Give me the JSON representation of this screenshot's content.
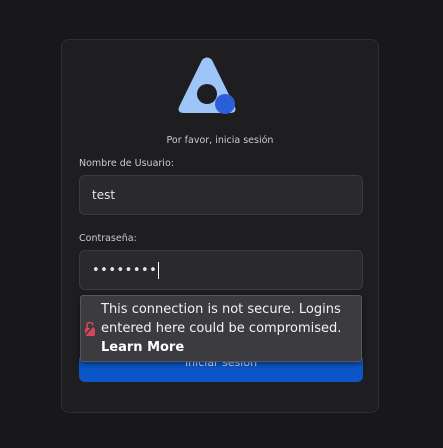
{
  "login": {
    "subtitle": "Por favor, inicia sesión",
    "username_label": "Nombre de Usuario:",
    "username_value": "test",
    "password_label": "Contraseña:",
    "password_value": "••••••••",
    "submit_label": "Iniciar sesión"
  },
  "security_popup": {
    "message": "This connection is not secure. Logins entered here could be compromised.",
    "link_label": "Learn More"
  },
  "colors": {
    "accent": "#0b57c9",
    "logo_light": "#9ec5f8",
    "logo_dot": "#2b5fd9",
    "warning_lock": "#d6455a"
  }
}
